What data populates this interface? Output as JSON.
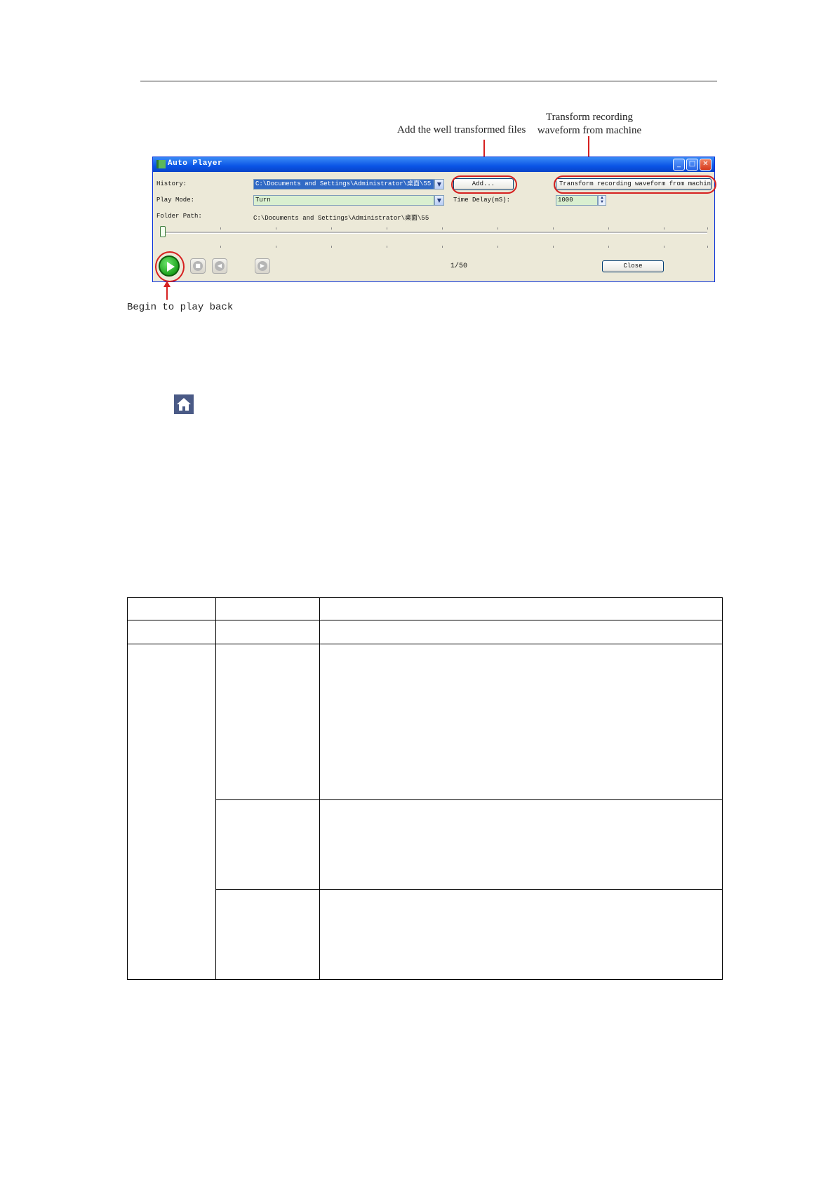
{
  "annotations": {
    "add_files": "Add the well transformed files",
    "transform": "Transform recording waveform from machine",
    "play_back": "Begin to play back"
  },
  "window": {
    "title": "Auto Player",
    "controls": {
      "minimize": "_",
      "maximize": "□",
      "close": "✕"
    },
    "history_label": "History:",
    "history_value": "C:\\Documents and Settings\\Administrator\\桌面\\55",
    "add_button": "Add...",
    "transform_button": "Transform recording waveform from machine",
    "play_mode_label": "Play Mode:",
    "play_mode_value": "Turn",
    "time_delay_label": "Time Delay(mS):",
    "time_delay_value": "1000",
    "folder_path_label": "Folder Path:",
    "folder_path_value": "C:\\Documents and Settings\\Administrator\\桌面\\55",
    "counter": "1/50",
    "close_button": "Close",
    "icons": {
      "stop": "■",
      "prev": "◀",
      "next": "▶"
    }
  }
}
